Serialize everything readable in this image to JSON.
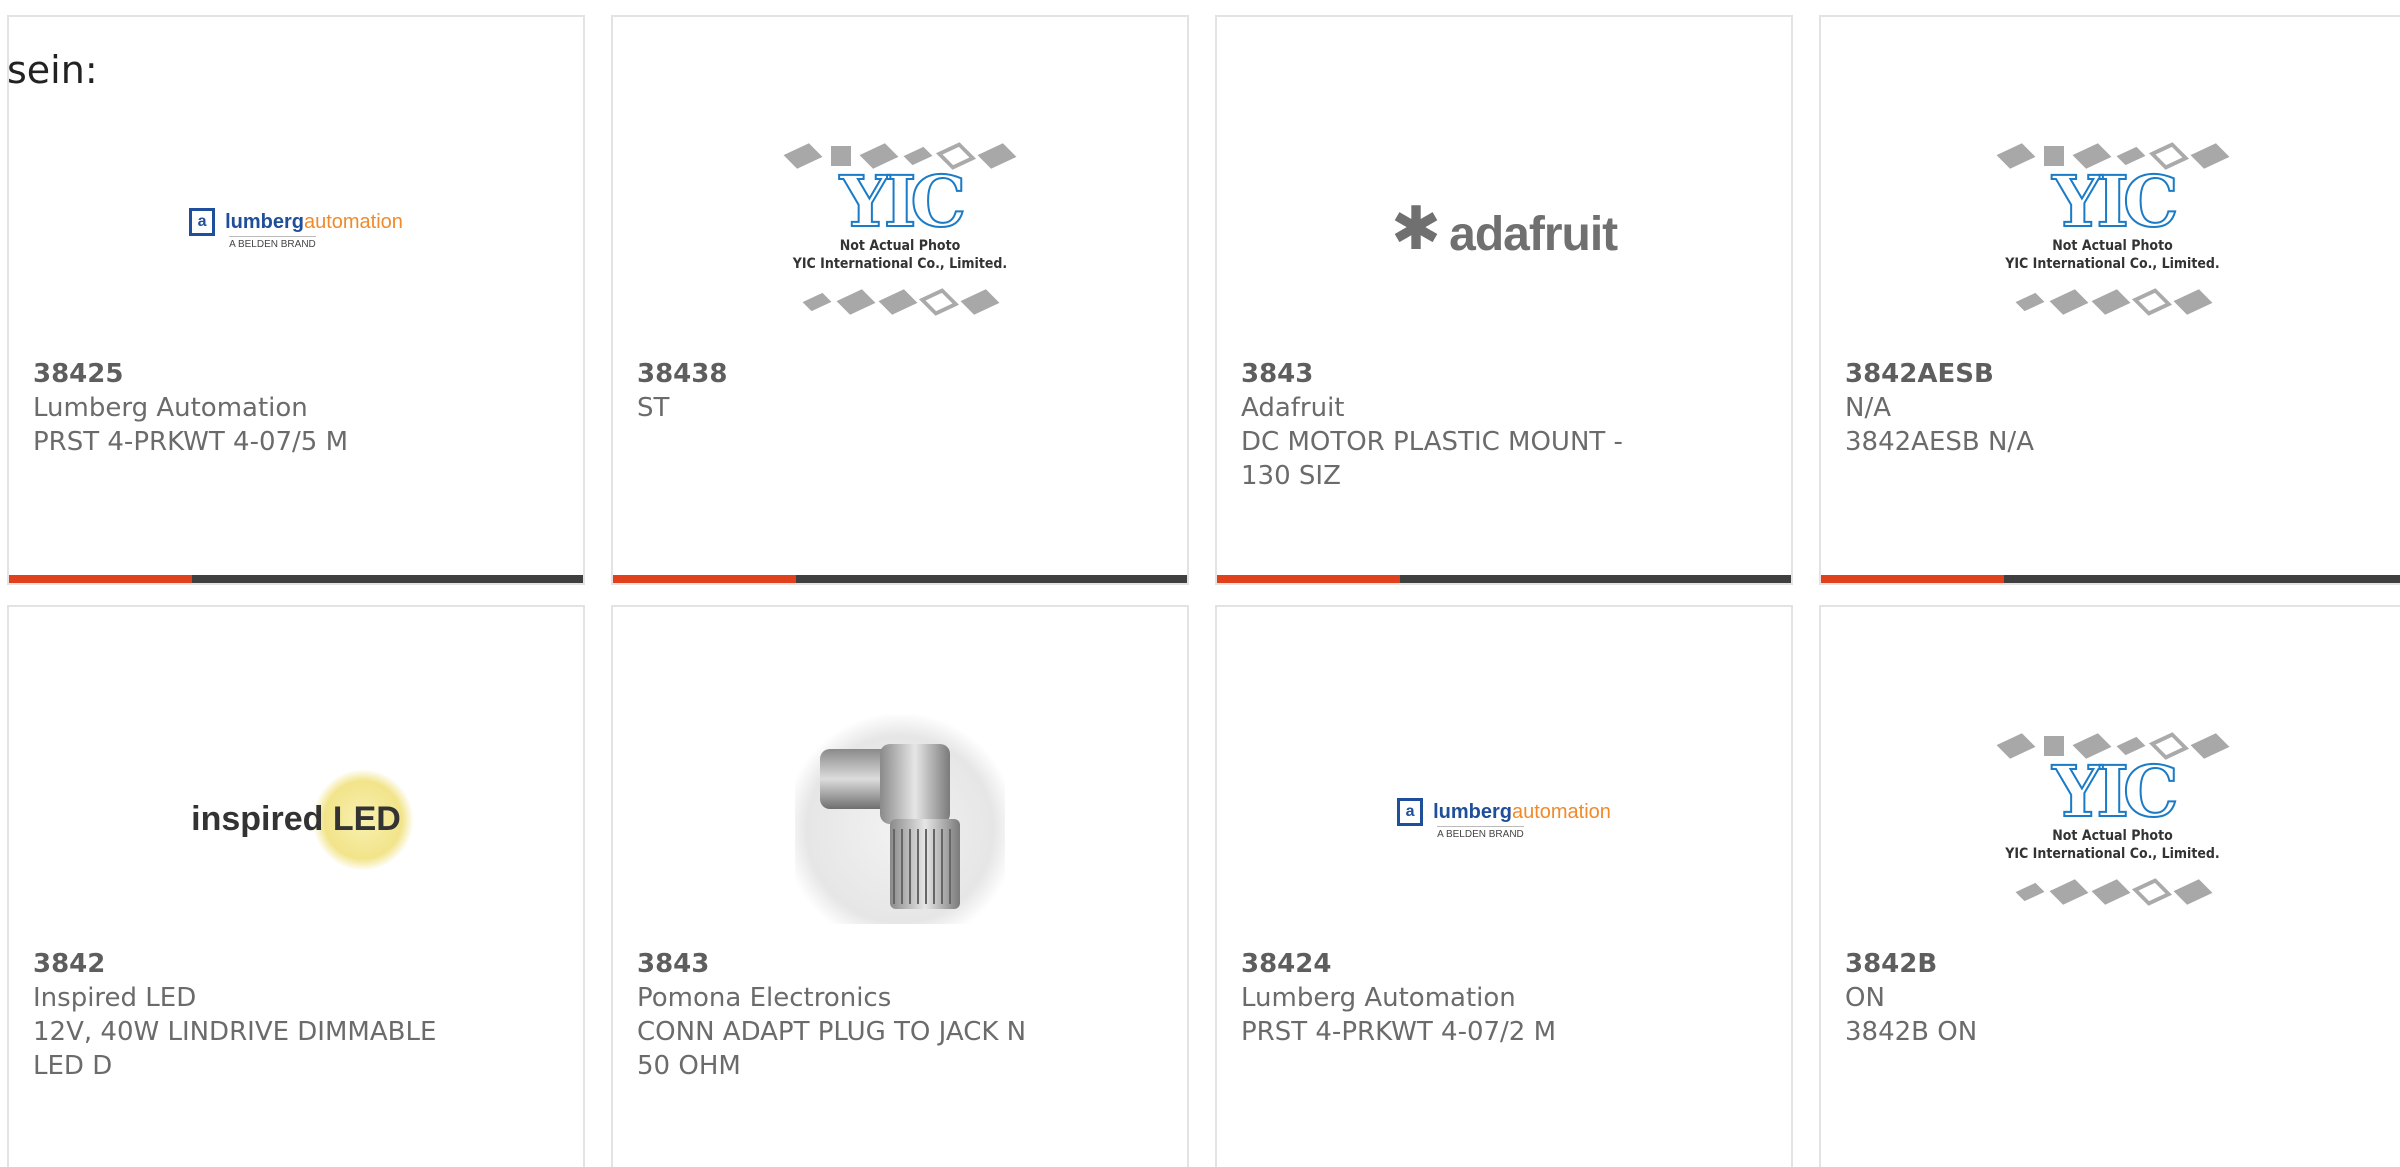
{
  "heading": "sein:",
  "products": [
    {
      "part_number": "38425",
      "manufacturer": "Lumberg Automation",
      "description": "PRST 4-PRKWT 4-07/5 M",
      "logo": "lumberg-automation-logo"
    },
    {
      "part_number": "38438",
      "manufacturer": "ST",
      "description": "",
      "logo": "yic-not-actual-photo"
    },
    {
      "part_number": "3843",
      "manufacturer": "Adafruit",
      "description": "DC MOTOR PLASTIC MOUNT - 130 SIZ",
      "logo": "adafruit-logo"
    },
    {
      "part_number": "3842AESB",
      "manufacturer": "N/A",
      "description": "3842AESB N/A",
      "logo": "yic-not-actual-photo"
    },
    {
      "part_number": "3842",
      "manufacturer": "Inspired LED",
      "description": "12V, 40W LINDRIVE DIMMABLE LED D",
      "logo": "inspired-led-logo"
    },
    {
      "part_number": "3843",
      "manufacturer": "Pomona Electronics",
      "description": "CONN ADAPT PLUG TO JACK N 50 OHM",
      "logo": "n-connector-photo"
    },
    {
      "part_number": "38424",
      "manufacturer": "Lumberg Automation",
      "description": "PRST 4-PRKWT 4-07/2 M",
      "logo": "lumberg-automation-logo"
    },
    {
      "part_number": "3842B",
      "manufacturer": "ON",
      "description": "3842B ON",
      "logo": "yic-not-actual-photo"
    }
  ],
  "logos": {
    "lumberg_box": "a",
    "lumberg_name1": "lumberg",
    "lumberg_name2": "automation",
    "lumberg_sub": "A BELDEN BRAND",
    "adafruit_name": "adafruit",
    "adafruit_star": "✱",
    "inspired_word1": "inspired",
    "inspired_word2": "LED",
    "yic_mark": "YIC",
    "yic_line1": "Not Actual Photo",
    "yic_line2": "YIC International Co., Limited."
  },
  "colors": {
    "accent": "#e0401c",
    "bar": "#3f3f3f",
    "text": "#6b6b6b",
    "yic_blue": "#1b7bc6",
    "lumberg_blue": "#1f4f9a",
    "lumberg_orange": "#f08a2a"
  }
}
